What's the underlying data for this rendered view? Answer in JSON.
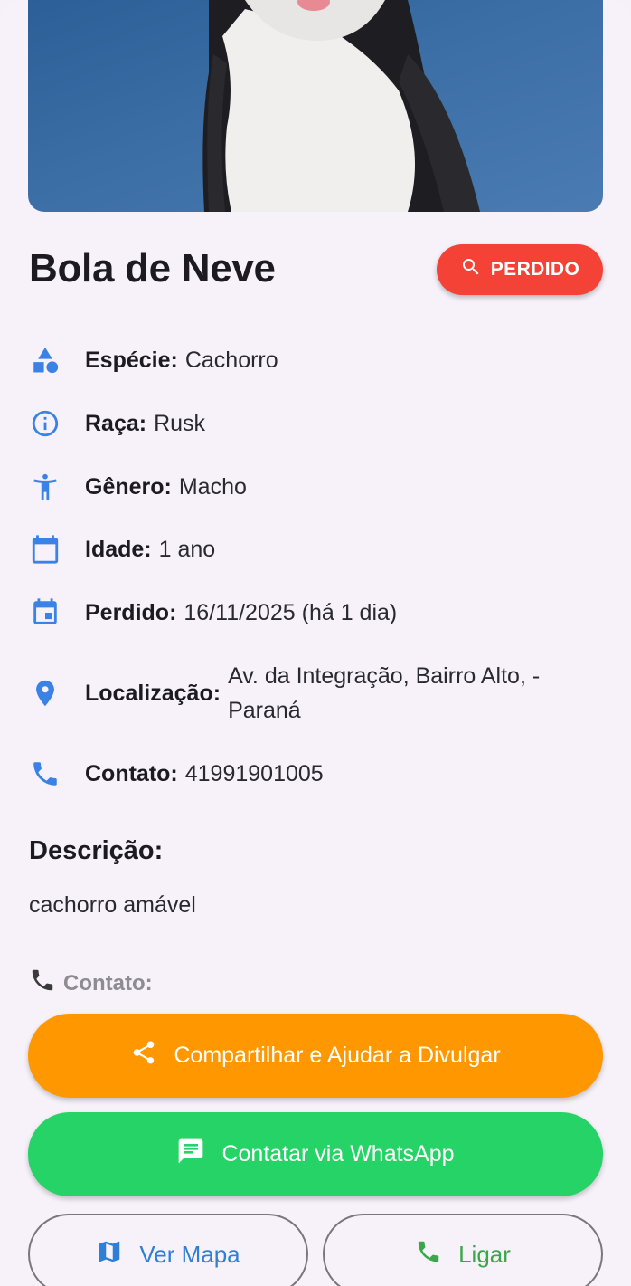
{
  "pet": {
    "name": "Bola de Neve",
    "status": "PERDIDO"
  },
  "details": [
    {
      "icon": "category-icon",
      "label": "Espécie:",
      "value": "Cachorro"
    },
    {
      "icon": "info-icon",
      "label": "Raça:",
      "value": "Rusk"
    },
    {
      "icon": "person-icon",
      "label": "Gênero:",
      "value": "Macho"
    },
    {
      "icon": "calendar-icon",
      "label": "Idade:",
      "value": "1 ano"
    },
    {
      "icon": "event-icon",
      "label": "Perdido:",
      "value": "16/11/2025 (há 1 dia)"
    },
    {
      "icon": "location-pin-icon",
      "label": "Localização:",
      "value_line1": "Av. da Integração, Bairro Alto,  -",
      "value_line2": "Paraná"
    },
    {
      "icon": "phone-icon",
      "label": "Contato:",
      "value": "41991901005"
    }
  ],
  "description": {
    "title": "Descrição:",
    "text": "cachorro amável"
  },
  "contact_section": {
    "label": "Contato:"
  },
  "actions": {
    "share_label": "Compartilhar e Ajudar a Divulgar",
    "whatsapp_label": "Contatar via WhatsApp",
    "map_label": "Ver Mapa",
    "call_label": "Ligar"
  },
  "colors": {
    "accent_blue": "#3b82e6",
    "status_red": "#f44336",
    "share_orange": "#ff9800",
    "whatsapp_green": "#25d366"
  }
}
